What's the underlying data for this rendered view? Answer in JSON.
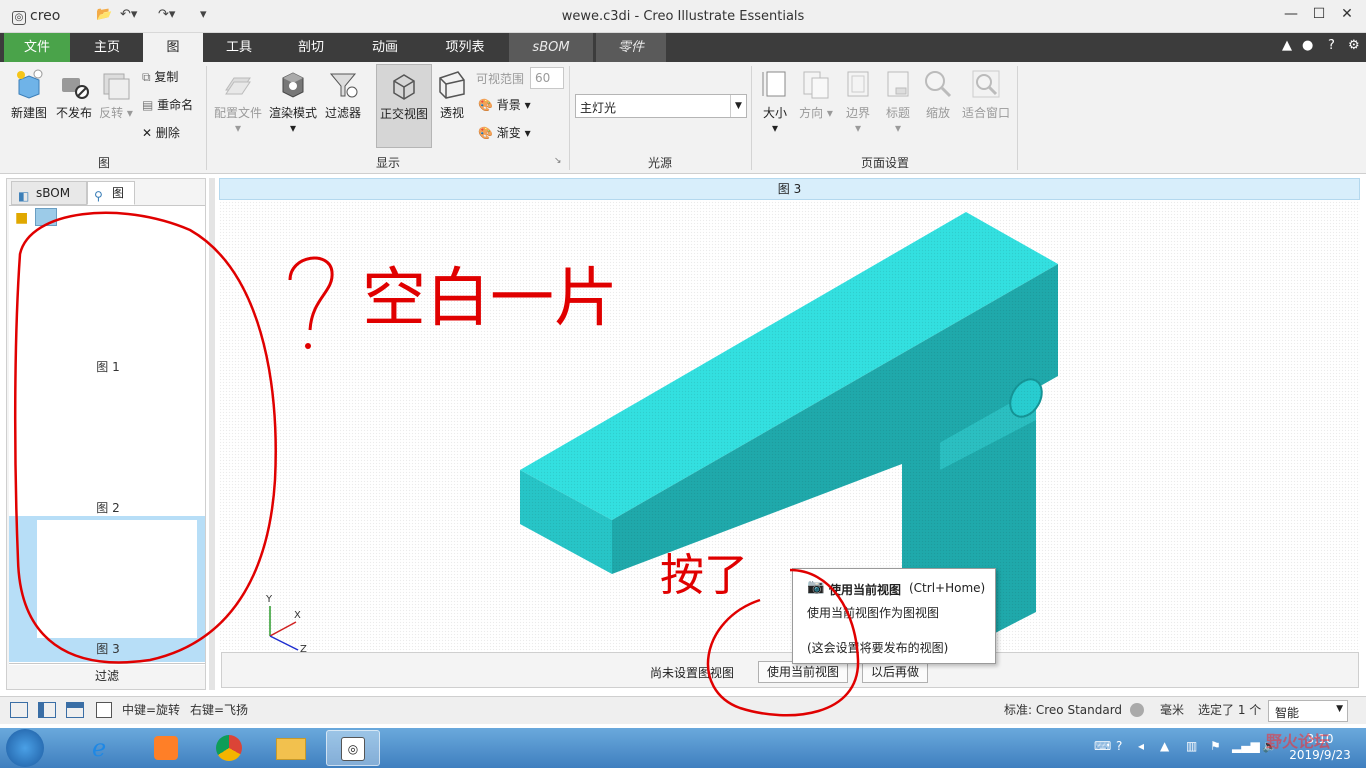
{
  "app": {
    "logo": "creo",
    "window_title": "wewe.c3di - Creo Illustrate Essentials"
  },
  "ribbon_tabs": [
    {
      "label": "文件"
    },
    {
      "label": "主页"
    },
    {
      "label": "图"
    },
    {
      "label": "工具"
    },
    {
      "label": "剖切"
    },
    {
      "label": "动画"
    },
    {
      "label": "项列表"
    },
    {
      "label": "sBOM"
    },
    {
      "label": "零件"
    }
  ],
  "ribbon": {
    "group_tu": {
      "label": "图",
      "new_figure": "新建图",
      "unpublish": "不发布",
      "reverse": "反转",
      "copy": "复制",
      "rename": "重命名",
      "delete": "删除"
    },
    "group_display": {
      "label": "显示",
      "config_file": "配置文件",
      "render_mode": "渲染模式",
      "filter": "过滤器",
      "ortho_view": "正交视图",
      "perspective": "透视",
      "view_range": "可视范围",
      "view_range_value": "60",
      "background": "背景",
      "gradient": "渐变"
    },
    "group_light": {
      "label": "光源",
      "selected": "主灯光"
    },
    "group_page": {
      "label": "页面设置",
      "size": "大小",
      "direction": "方向",
      "border": "边界",
      "title": "标题",
      "zoom": "缩放",
      "fit_window": "适合窗口"
    }
  },
  "left_panel": {
    "tab_sbom": "sBOM",
    "tab_figure": "图",
    "figures": [
      {
        "label": "图 1"
      },
      {
        "label": "图 2"
      },
      {
        "label": "图 3"
      }
    ],
    "filter": "过滤"
  },
  "viewport": {
    "header": "图 3",
    "axes": {
      "y": "Y",
      "x": "X",
      "z": "Z"
    },
    "footer_status": "尚未设置图视图",
    "use_current_btn": "使用当前视图",
    "later_btn": "以后再做"
  },
  "popup": {
    "title": "使用当前视图",
    "shortcut": "(Ctrl+Home)",
    "desc": "使用当前视图作为图视图",
    "note": "(这会设置将要发布的视图)"
  },
  "statusbar": {
    "middle_rotate": "中键=旋转",
    "right_fly": "右键=飞扬",
    "standard": "标准: Creo Standard",
    "units": "毫米",
    "selected": "选定了 1 个",
    "smart": "智能"
  },
  "taskbar": {
    "time": "3:10",
    "date": "2019/9/23",
    "watermark": "野火论坛"
  },
  "annotations": {
    "question": "?",
    "blank_text": "空白一片",
    "click_text": "按了"
  },
  "colors": {
    "model": "#33e0e0",
    "model_dark": "#1fa9ab",
    "model_side": "#27c5c7",
    "tab_file": "#4aa34a",
    "annotation": "#e00000"
  }
}
